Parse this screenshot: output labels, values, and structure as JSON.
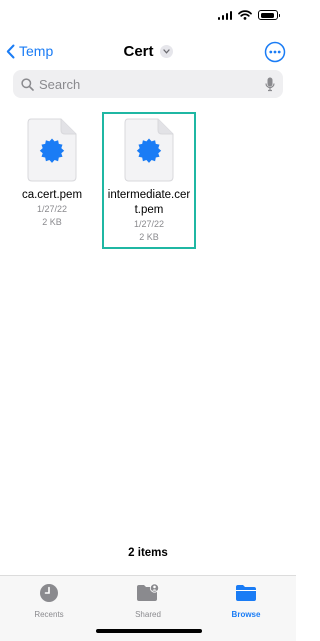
{
  "nav": {
    "back_label": "Temp",
    "title": "Cert"
  },
  "search": {
    "placeholder": "Search"
  },
  "files": [
    {
      "name": "ca.cert.pem",
      "date": "1/27/22",
      "size": "2 KB"
    },
    {
      "name": "intermediate.cert.pem",
      "date": "1/27/22",
      "size": "2 KB",
      "selected": true
    }
  ],
  "footer": {
    "count": "2 items"
  },
  "tabs": [
    {
      "label": "Recents",
      "icon": "clock-icon"
    },
    {
      "label": "Shared",
      "icon": "shared-folder-icon"
    },
    {
      "label": "Browse",
      "icon": "folder-icon",
      "active": true
    }
  ],
  "colors": {
    "accent": "#1a7cf5",
    "cert_icon": "#1a7cf5",
    "selection": "#1fb7a3"
  }
}
